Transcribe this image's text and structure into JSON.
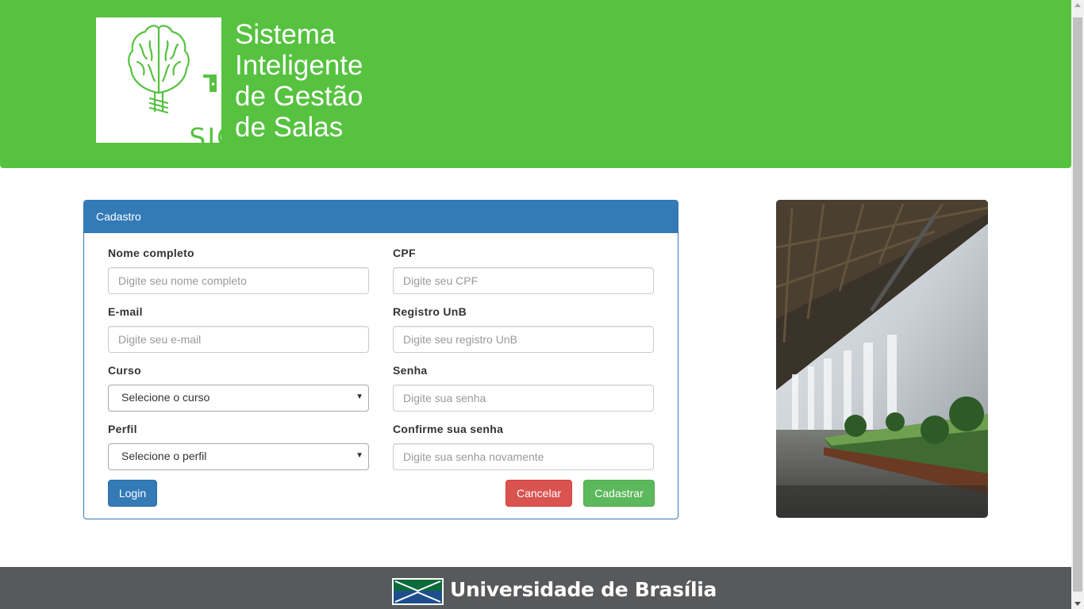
{
  "header": {
    "logo_text": "SIGS",
    "title_lines": [
      "Sistema",
      "Inteligente",
      "de Gestão",
      "de Salas"
    ]
  },
  "form": {
    "heading": "Cadastro",
    "fields": {
      "nome": {
        "label": "Nome completo",
        "placeholder": "Digite seu nome completo"
      },
      "cpf": {
        "label": "CPF",
        "placeholder": "Digite seu CPF"
      },
      "email": {
        "label": "E-mail",
        "placeholder": "Digite seu e-mail"
      },
      "registro": {
        "label": "Registro UnB",
        "placeholder": "Digite seu registro UnB"
      },
      "curso": {
        "label": "Curso",
        "selected": "Selecione o curso"
      },
      "senha": {
        "label": "Senha",
        "placeholder": "Digite sua senha"
      },
      "perfil": {
        "label": "Perfil",
        "selected": "Selecione o perfil"
      },
      "confirma": {
        "label": "Confirme sua senha",
        "placeholder": "Digite sua senha novamente"
      }
    },
    "buttons": {
      "login": "Login",
      "cancel": "Cancelar",
      "submit": "Cadastrar"
    }
  },
  "footer": {
    "university": "Universidade de Brasília"
  },
  "icons": {
    "logo": "brain-tree-key-icon",
    "select_caret": "caret-down-icon",
    "unb_flag": "unb-flag-icon"
  },
  "colors": {
    "header_bg": "#56c240",
    "panel_primary": "#337ab7",
    "danger": "#d9534f",
    "success": "#5cb85c",
    "footer_bg": "#58595b"
  }
}
